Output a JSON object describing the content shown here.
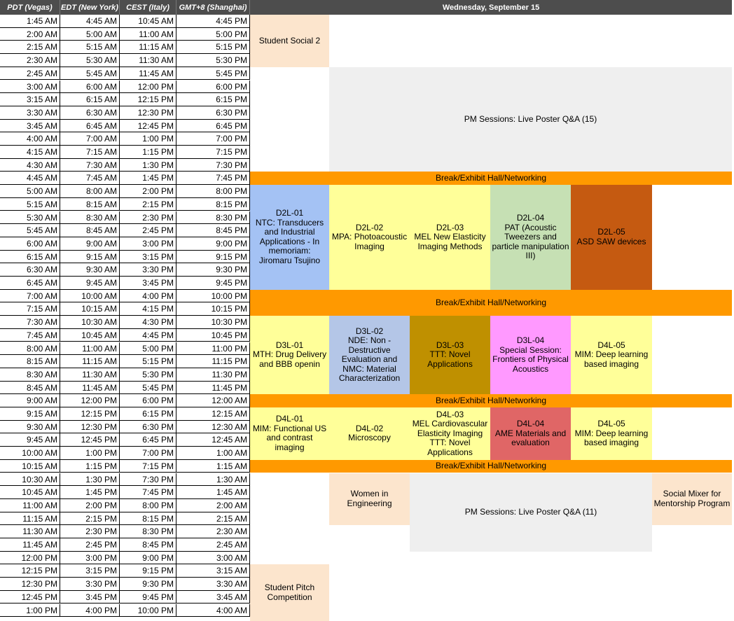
{
  "header": {
    "columns": [
      "PDT (Vegas)",
      "EDT (New York)",
      "CEST (Italy)",
      "GMT+8 (Shanghai)"
    ],
    "day": "Wednesday, September 15"
  },
  "times": [
    [
      "1:45 AM",
      "4:45 AM",
      "10:45 AM",
      "4:45 PM"
    ],
    [
      "2:00 AM",
      "5:00 AM",
      "11:00 AM",
      "5:00 PM"
    ],
    [
      "2:15 AM",
      "5:15 AM",
      "11:15 AM",
      "5:15 PM"
    ],
    [
      "2:30 AM",
      "5:30 AM",
      "11:30 AM",
      "5:30 PM"
    ],
    [
      "2:45 AM",
      "5:45 AM",
      "11:45 AM",
      "5:45 PM"
    ],
    [
      "3:00 AM",
      "6:00 AM",
      "12:00 PM",
      "6:00 PM"
    ],
    [
      "3:15 AM",
      "6:15 AM",
      "12:15 PM",
      "6:15 PM"
    ],
    [
      "3:30 AM",
      "6:30 AM",
      "12:30 PM",
      "6:30 PM"
    ],
    [
      "3:45 AM",
      "6:45 AM",
      "12:45 PM",
      "6:45 PM"
    ],
    [
      "4:00 AM",
      "7:00 AM",
      "1:00 PM",
      "7:00 PM"
    ],
    [
      "4:15 AM",
      "7:15 AM",
      "1:15 PM",
      "7:15 PM"
    ],
    [
      "4:30 AM",
      "7:30 AM",
      "1:30 PM",
      "7:30 PM"
    ],
    [
      "4:45 AM",
      "7:45 AM",
      "1:45 PM",
      "7:45 PM"
    ],
    [
      "5:00 AM",
      "8:00 AM",
      "2:00 PM",
      "8:00 PM"
    ],
    [
      "5:15 AM",
      "8:15 AM",
      "2:15 PM",
      "8:15 PM"
    ],
    [
      "5:30 AM",
      "8:30 AM",
      "2:30 PM",
      "8:30 PM"
    ],
    [
      "5:45 AM",
      "8:45 AM",
      "2:45 PM",
      "8:45 PM"
    ],
    [
      "6:00 AM",
      "9:00 AM",
      "3:00 PM",
      "9:00 PM"
    ],
    [
      "6:15 AM",
      "9:15 AM",
      "3:15 PM",
      "9:15 PM"
    ],
    [
      "6:30 AM",
      "9:30 AM",
      "3:30 PM",
      "9:30 PM"
    ],
    [
      "6:45 AM",
      "9:45 AM",
      "3:45 PM",
      "9:45 PM"
    ],
    [
      "7:00 AM",
      "10:00 AM",
      "4:00 PM",
      "10:00 PM"
    ],
    [
      "7:15 AM",
      "10:15 AM",
      "4:15 PM",
      "10:15 PM"
    ],
    [
      "7:30 AM",
      "10:30 AM",
      "4:30 PM",
      "10:30 PM"
    ],
    [
      "7:45 AM",
      "10:45 AM",
      "4:45 PM",
      "10:45 PM"
    ],
    [
      "8:00 AM",
      "11:00 AM",
      "5:00 PM",
      "11:00 PM"
    ],
    [
      "8:15 AM",
      "11:15 AM",
      "5:15 PM",
      "11:15 PM"
    ],
    [
      "8:30 AM",
      "11:30 AM",
      "5:30 PM",
      "11:30 PM"
    ],
    [
      "8:45 AM",
      "11:45 AM",
      "5:45 PM",
      "11:45 PM"
    ],
    [
      "9:00 AM",
      "12:00 PM",
      "6:00 PM",
      "12:00 AM"
    ],
    [
      "9:15 AM",
      "12:15 PM",
      "6:15 PM",
      "12:15 AM"
    ],
    [
      "9:30 AM",
      "12:30 PM",
      "6:30 PM",
      "12:30 AM"
    ],
    [
      "9:45 AM",
      "12:45 PM",
      "6:45 PM",
      "12:45 AM"
    ],
    [
      "10:00 AM",
      "1:00 PM",
      "7:00 PM",
      "1:00 AM"
    ],
    [
      "10:15 AM",
      "1:15 PM",
      "7:15 PM",
      "1:15 AM"
    ],
    [
      "10:30 AM",
      "1:30 PM",
      "7:30 PM",
      "1:30 AM"
    ],
    [
      "10:45 AM",
      "1:45 PM",
      "7:45 PM",
      "1:45 AM"
    ],
    [
      "11:00 AM",
      "2:00 PM",
      "8:00 PM",
      "2:00 AM"
    ],
    [
      "11:15 AM",
      "2:15 PM",
      "8:15 PM",
      "2:15 AM"
    ],
    [
      "11:30 AM",
      "2:30 PM",
      "8:30 PM",
      "2:30 AM"
    ],
    [
      "11:45 AM",
      "2:45 PM",
      "8:45 PM",
      "2:45 AM"
    ],
    [
      "12:00 PM",
      "3:00 PM",
      "9:00 PM",
      "3:00 AM"
    ],
    [
      "12:15 PM",
      "3:15 PM",
      "9:15 PM",
      "3:15 AM"
    ],
    [
      "12:30 PM",
      "3:30 PM",
      "9:30 PM",
      "3:30 AM"
    ],
    [
      "12:45 PM",
      "3:45 PM",
      "9:45 PM",
      "3:45 AM"
    ],
    [
      "1:00 PM",
      "4:00 PM",
      "10:00 PM",
      "4:00 AM"
    ]
  ],
  "events": [
    {
      "name": "student-social-2",
      "label": "Student Social 2",
      "color": "#fce5cd"
    },
    {
      "name": "pm-poster-qa-15",
      "label": "PM Sessions: Live Poster Q&A (15)",
      "color": "#efefef"
    },
    {
      "name": "break-1",
      "label": "Break/Exhibit Hall/Networking",
      "color": "#ff9900"
    },
    {
      "name": "d2l-01",
      "label": "D2L-01\nNTC: Transducers and Industrial Applications - In memoriam: Jiromaru Tsujino",
      "color": "#a4c2f4"
    },
    {
      "name": "d2l-02",
      "label": "D2L-02\nMPA: Photoacoustic Imaging",
      "color": "#ffff99"
    },
    {
      "name": "d2l-03",
      "label": "D2L-03\nMEL New Elasticity Imaging Methods",
      "color": "#ffff99"
    },
    {
      "name": "d2l-04",
      "label": "D2L-04\nPAT (Acoustic Tweezers and particle manipulation III)",
      "color": "#c6e0b4"
    },
    {
      "name": "d2l-05",
      "label": "D2L-05\nASD SAW devices",
      "color": "#c55a11"
    },
    {
      "name": "break-2",
      "label": "Break/Exhibit Hall/Networking",
      "color": "#ff9900"
    },
    {
      "name": "d3l-01",
      "label": "D3L-01\nMTH: Drug Delivery and BBB openin",
      "color": "#ffff99"
    },
    {
      "name": "d3l-02",
      "label": "D3L-02\nNDE: Non - Destructive Evaluation and NMC: Material Characterization",
      "color": "#b4c6e7"
    },
    {
      "name": "d3l-03",
      "label": "D3L-03\nTTT: Novel Applications",
      "color": "#bf9000"
    },
    {
      "name": "d3l-04",
      "label": "D3L-04\nSpecial Session: Frontiers of Physical Acoustics",
      "color": "#ff99ff"
    },
    {
      "name": "d4l-05-a",
      "label": "D4L-05\nMIM: Deep learning based imaging",
      "color": "#ffff99"
    },
    {
      "name": "break-3",
      "label": "Break/Exhibit Hall/Networking",
      "color": "#ff9900"
    },
    {
      "name": "d4l-01",
      "label": "D4L-01\nMIM: Functional US and contrast imaging",
      "color": "#ffff99"
    },
    {
      "name": "d4l-02",
      "label": "D4L-02\nMicroscopy",
      "color": "#ffff99"
    },
    {
      "name": "d4l-03",
      "label": "D4L-03\nMEL Cardiovascular Elasticity Imaging\nTTT: Novel Applications",
      "color": "#ffff99"
    },
    {
      "name": "d4l-04",
      "label": "D4L-04\nAME Materials and evaluation",
      "color": "#e06666"
    },
    {
      "name": "d4l-05-b",
      "label": "D4L-05\nMIM: Deep learning based imaging",
      "color": "#ffff99"
    },
    {
      "name": "break-4",
      "label": "Break/Exhibit Hall/Networking",
      "color": "#ff9900"
    },
    {
      "name": "women-in-engineering",
      "label": "Women in Engineering",
      "color": "#fce5cd"
    },
    {
      "name": "pm-poster-qa-11",
      "label": "PM Sessions: Live Poster Q&A (11)",
      "color": "#efefef"
    },
    {
      "name": "social-mixer",
      "label": "Social Mixer for Mentorship Program",
      "color": "#fce5cd"
    },
    {
      "name": "student-pitch",
      "label": "Student Pitch Competition",
      "color": "#fce5cd"
    }
  ]
}
